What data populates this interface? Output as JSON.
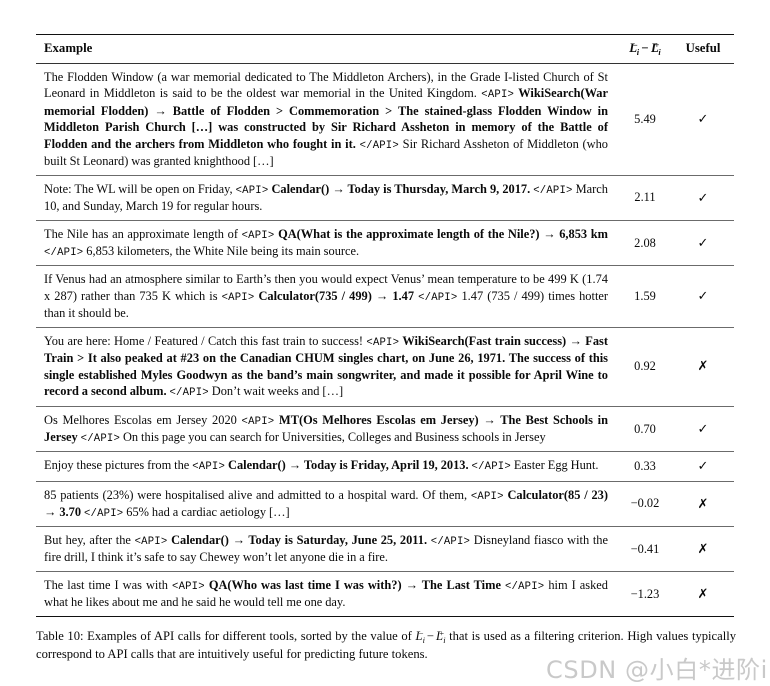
{
  "table": {
    "headers": {
      "example": "Example",
      "score_plain": "L_i^- - L_i^+",
      "score_parts": {
        "l": "L",
        "sub": "i",
        "sup_minus": "−",
        "op": "−",
        "sup_plus": "+"
      },
      "useful": "Useful"
    },
    "marks": {
      "yes": "✓",
      "no": "✗"
    },
    "rows": [
      {
        "id": "row-flodden",
        "score": "5.49",
        "useful": "✓",
        "useful_value": true,
        "tool": "WikiSearch",
        "segments": [
          {
            "type": "plain",
            "text": "The Flodden Window (a war memorial dedicated to The Middleton Archers), in the Grade I-listed Church of St Leonard in Middleton is said to be the oldest war memorial in the United Kingdom. "
          },
          {
            "type": "tag",
            "text": "<API>"
          },
          {
            "type": "bold",
            "text": " WikiSearch(War memorial Flodden) → Battle of Flodden > Commemoration > The stained-glass Flodden Window in Middleton Parish Church […] was constructed by Sir Richard Assheton in memory of the Battle of Flodden and the archers from Middleton who fought in it. "
          },
          {
            "type": "tag",
            "text": "</API>"
          },
          {
            "type": "plain",
            "text": " Sir Richard Assheton of Middleton (who built St Leonard) was granted knighthood […]"
          }
        ]
      },
      {
        "id": "row-calendar-wl",
        "score": "2.11",
        "useful": "✓",
        "useful_value": true,
        "tool": "Calendar",
        "segments": [
          {
            "type": "plain",
            "text": "Note: The WL will be open on Friday, "
          },
          {
            "type": "tag",
            "text": "<API>"
          },
          {
            "type": "bold",
            "text": " Calendar() → Today is Thursday, March 9, 2017. "
          },
          {
            "type": "tag",
            "text": "</API>"
          },
          {
            "type": "plain",
            "text": " March 10, and Sunday, March 19 for regular hours."
          }
        ]
      },
      {
        "id": "row-nile",
        "score": "2.08",
        "useful": "✓",
        "useful_value": true,
        "tool": "QA",
        "segments": [
          {
            "type": "plain",
            "text": "The Nile has an approximate length of "
          },
          {
            "type": "tag",
            "text": "<API>"
          },
          {
            "type": "bold",
            "text": " QA(What is the approximate length of the Nile?) → 6,853 km "
          },
          {
            "type": "tag",
            "text": "</API>"
          },
          {
            "type": "plain",
            "text": " 6,853 kilometers, the White Nile being its main source."
          }
        ]
      },
      {
        "id": "row-venus",
        "score": "1.59",
        "useful": "✓",
        "useful_value": true,
        "tool": "Calculator",
        "segments": [
          {
            "type": "plain",
            "text": "If Venus had an atmosphere similar to Earth’s then you would expect Venus’ mean temperature to be 499 K (1.74 x 287) rather than 735 K which is "
          },
          {
            "type": "tag",
            "text": "<API>"
          },
          {
            "type": "bold",
            "text": " Calculator(735 / 499) → 1.47 "
          },
          {
            "type": "tag",
            "text": "</API>"
          },
          {
            "type": "plain",
            "text": " 1.47 (735 / 499) times hotter than it should be."
          }
        ]
      },
      {
        "id": "row-fast-train",
        "score": "0.92",
        "useful": "✗",
        "useful_value": false,
        "tool": "WikiSearch",
        "segments": [
          {
            "type": "plain",
            "text": "You are here: Home / Featured / Catch this fast train to success! "
          },
          {
            "type": "tag",
            "text": "<API>"
          },
          {
            "type": "bold",
            "text": " WikiSearch(Fast train success) → Fast Train > It also peaked at #23 on the Canadian CHUM singles chart, on June 26, 1971. The success of this single established Myles Goodwyn as the band’s main songwriter, and made it possible for April Wine to record a second album. "
          },
          {
            "type": "tag",
            "text": "</API>"
          },
          {
            "type": "plain",
            "text": " Don’t wait weeks and […]"
          }
        ]
      },
      {
        "id": "row-jersey",
        "score": "0.70",
        "useful": "✓",
        "useful_value": true,
        "tool": "MT",
        "segments": [
          {
            "type": "plain",
            "text": "Os Melhores Escolas em Jersey 2020 "
          },
          {
            "type": "tag",
            "text": "<API>"
          },
          {
            "type": "bold",
            "text": " MT(Os Melhores Escolas em Jersey) → The Best Schools in Jersey "
          },
          {
            "type": "tag",
            "text": "</API>"
          },
          {
            "type": "plain",
            "text": " On this page you can search for Universities, Colleges and Business schools in Jersey"
          }
        ]
      },
      {
        "id": "row-easter",
        "score": "0.33",
        "useful": "✓",
        "useful_value": true,
        "tool": "Calendar",
        "segments": [
          {
            "type": "plain",
            "text": "Enjoy these pictures from the "
          },
          {
            "type": "tag",
            "text": "<API>"
          },
          {
            "type": "bold",
            "text": " Calendar() → Today is Friday, April 19, 2013. "
          },
          {
            "type": "tag",
            "text": "</API>"
          },
          {
            "type": "plain",
            "text": " Easter Egg Hunt."
          }
        ]
      },
      {
        "id": "row-patients",
        "score": "−0.02",
        "useful": "✗",
        "useful_value": false,
        "tool": "Calculator",
        "segments": [
          {
            "type": "plain",
            "text": "85 patients (23%) were hospitalised alive and admitted to a hospital ward. Of them, "
          },
          {
            "type": "tag",
            "text": "<API>"
          },
          {
            "type": "bold",
            "text": " Calculator(85 / 23) → 3.70 "
          },
          {
            "type": "tag",
            "text": "</API>"
          },
          {
            "type": "plain",
            "text": " 65% had a cardiac aetiology […]"
          }
        ]
      },
      {
        "id": "row-disneyland",
        "score": "−0.41",
        "useful": "✗",
        "useful_value": false,
        "tool": "Calendar",
        "segments": [
          {
            "type": "plain",
            "text": "But hey, after the "
          },
          {
            "type": "tag",
            "text": "<API>"
          },
          {
            "type": "bold",
            "text": " Calendar() → Today is Saturday, June 25, 2011. "
          },
          {
            "type": "tag",
            "text": "</API>"
          },
          {
            "type": "plain",
            "text": " Disneyland fiasco with the fire drill, I think it’s safe to say Chewey won’t let anyone die in a fire."
          }
        ]
      },
      {
        "id": "row-last-time",
        "score": "−1.23",
        "useful": "✗",
        "useful_value": false,
        "tool": "QA",
        "segments": [
          {
            "type": "plain",
            "text": "The last time I was with "
          },
          {
            "type": "tag",
            "text": "<API>"
          },
          {
            "type": "bold",
            "text": " QA(Who was last time I was with?) → The Last Time "
          },
          {
            "type": "tag",
            "text": "</API>"
          },
          {
            "type": "plain",
            "text": " him I asked what he likes about me and he said he would tell me one day."
          }
        ]
      }
    ]
  },
  "caption": {
    "label": "Table 10:",
    "text_before": " Examples of API calls for different tools, sorted by the value of ",
    "math": "L_i^- - L_i^+",
    "text_after": " that is used as a filtering criterion. High values typically correspond to API calls that are intuitively useful for predicting future tokens."
  },
  "watermark": {
    "text": "CSDN @小白*进阶ing"
  }
}
